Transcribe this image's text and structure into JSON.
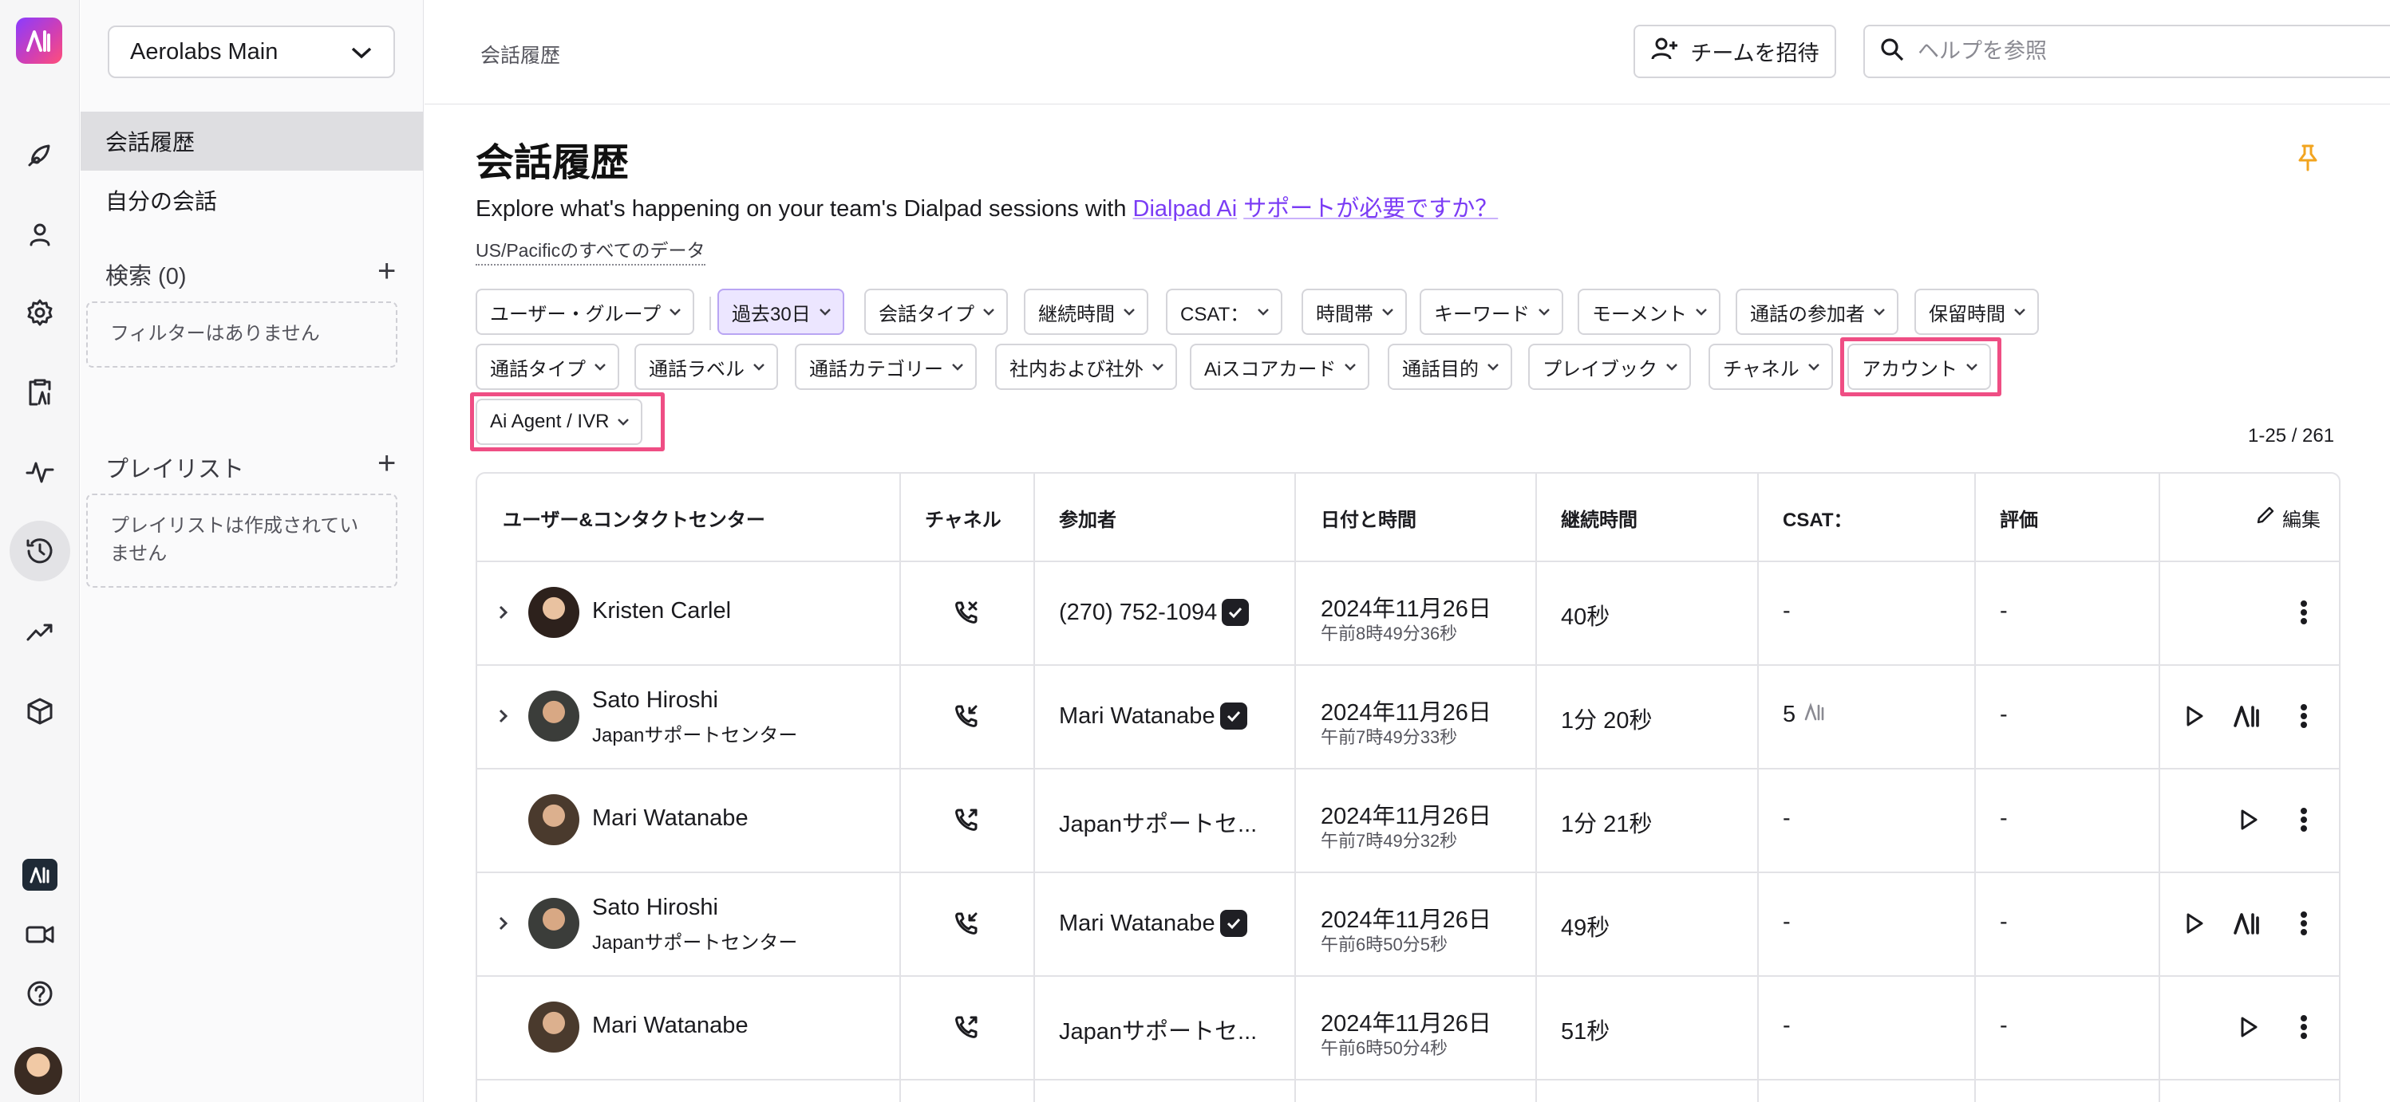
{
  "sidebar": {
    "workspace": "Aerolabs Main",
    "nav": [
      {
        "label": "会話履歴",
        "selected": true
      },
      {
        "label": "自分の会話",
        "selected": false
      }
    ],
    "search_title": "検索 (0)",
    "search_empty": "フィルターはありません",
    "playlist_title": "プレイリスト",
    "playlist_empty": "プレイリストは作成されていません"
  },
  "header": {
    "breadcrumb": "会話履歴",
    "invite_label": "チームを招待",
    "help_placeholder": "ヘルプを参照"
  },
  "page": {
    "title": "会話履歴",
    "subtitle_text": "Explore what's happening on your team's Dialpad sessions with",
    "subtitle_link1": "Dialpad Ai",
    "subtitle_link2": "サポートが必要ですか？",
    "timezone_link": "US/Pacificのすべてのデータ",
    "count": "1-25 / 261"
  },
  "filters": [
    "ユーザー・グループ",
    "過去30日",
    "会話タイプ",
    "継続時間",
    "CSAT：",
    "時間帯",
    "キーワード",
    "モーメント",
    "通話の参加者",
    "保留時間",
    "通話タイプ",
    "通話ラベル",
    "通話カテゴリー",
    "社内および社外",
    "Aiスコアカード",
    "通話目的",
    "プレイブック",
    "チャネル",
    "アカウント",
    "Ai Agent / IVR"
  ],
  "table": {
    "columns": [
      "ユーザー&コンタクトセンター",
      "チャネル",
      "参加者",
      "日付と時間",
      "継続時間",
      "CSAT：",
      "評価",
      "編集"
    ],
    "rows": [
      {
        "name": "Kristen Carlel",
        "team": "",
        "channel": "missed",
        "participant": "(270) 752-1094",
        "date": "2024年11月26日",
        "time": "午前8時49分36秒",
        "duration": "40秒",
        "csat": "-",
        "rating": "-"
      },
      {
        "name": "Sato Hiroshi",
        "team": "Japanサポートセンター",
        "channel": "incoming",
        "participant": "Mari Watanabe",
        "date": "2024年11月26日",
        "time": "午前7時49分33秒",
        "duration": "1分 20秒",
        "csat": "5",
        "rating": "-"
      },
      {
        "name": "Mari Watanabe",
        "team": "",
        "channel": "outgoing",
        "participant": "Japanサポートセ...",
        "date": "2024年11月26日",
        "time": "午前7時49分32秒",
        "duration": "1分 21秒",
        "csat": "-",
        "rating": "-"
      },
      {
        "name": "Sato Hiroshi",
        "team": "Japanサポートセンター",
        "channel": "incoming",
        "participant": "Mari Watanabe",
        "date": "2024年11月26日",
        "time": "午前6時50分5秒",
        "duration": "49秒",
        "csat": "-",
        "rating": "-"
      },
      {
        "name": "Mari Watanabe",
        "team": "",
        "channel": "outgoing",
        "participant": "Japanサポートセ...",
        "date": "2024年11月26日",
        "time": "午前6時50分4秒",
        "duration": "51秒",
        "csat": "-",
        "rating": "-"
      }
    ]
  },
  "colors": {
    "accent": "#7b3cf5",
    "highlight": "#ef4e84",
    "pin": "#f2a41f"
  }
}
